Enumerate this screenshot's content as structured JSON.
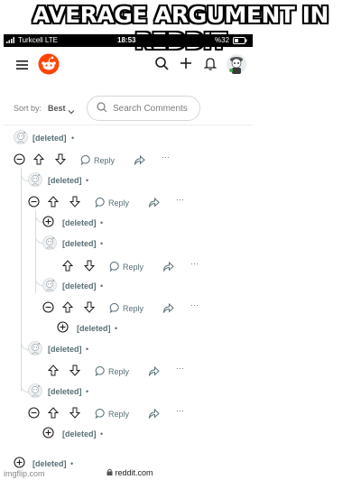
{
  "meme": {
    "title": "AVERAGE ARGUMENT IN REDDIT",
    "watermark": "imgflip.com"
  },
  "status": {
    "carrier": "Turkcell  LTE",
    "time": "18:53",
    "battery": "%32"
  },
  "sort": {
    "label": "Sort by:",
    "value": "Best"
  },
  "search": {
    "placeholder": "Search Comments"
  },
  "comments": [
    {
      "user": "[deleted]",
      "dot": "•"
    },
    {
      "user": "[deleted]",
      "dot": "•"
    },
    {
      "user": "[deleted]",
      "dot": "•"
    },
    {
      "user": "[deleted]",
      "dot": "•"
    },
    {
      "user": "[deleted]",
      "dot": "•"
    },
    {
      "user": "[deleted]",
      "dot": "•"
    },
    {
      "user": "[deleted]",
      "dot": "•"
    },
    {
      "user": "[deleted]",
      "dot": "•"
    },
    {
      "user": "[deleted]",
      "dot": "•"
    },
    {
      "user": "[deleted]",
      "dot": "•"
    },
    {
      "user": "[deleted]",
      "dot": "•"
    }
  ],
  "actions": {
    "reply": "Reply",
    "more": "···"
  },
  "footer": {
    "url": "reddit.com"
  },
  "colors": {
    "reddit_orange": "#ff4500",
    "meta": "#576f76",
    "thread_line": "#d7dadc"
  },
  "icons": [
    "menu-icon",
    "reddit-logo-icon",
    "search-icon",
    "plus-icon",
    "bell-icon",
    "avatar-icon",
    "upvote-icon",
    "downvote-icon",
    "reply-icon",
    "share-icon",
    "collapse-icon",
    "expand-icon",
    "lock-icon"
  ]
}
